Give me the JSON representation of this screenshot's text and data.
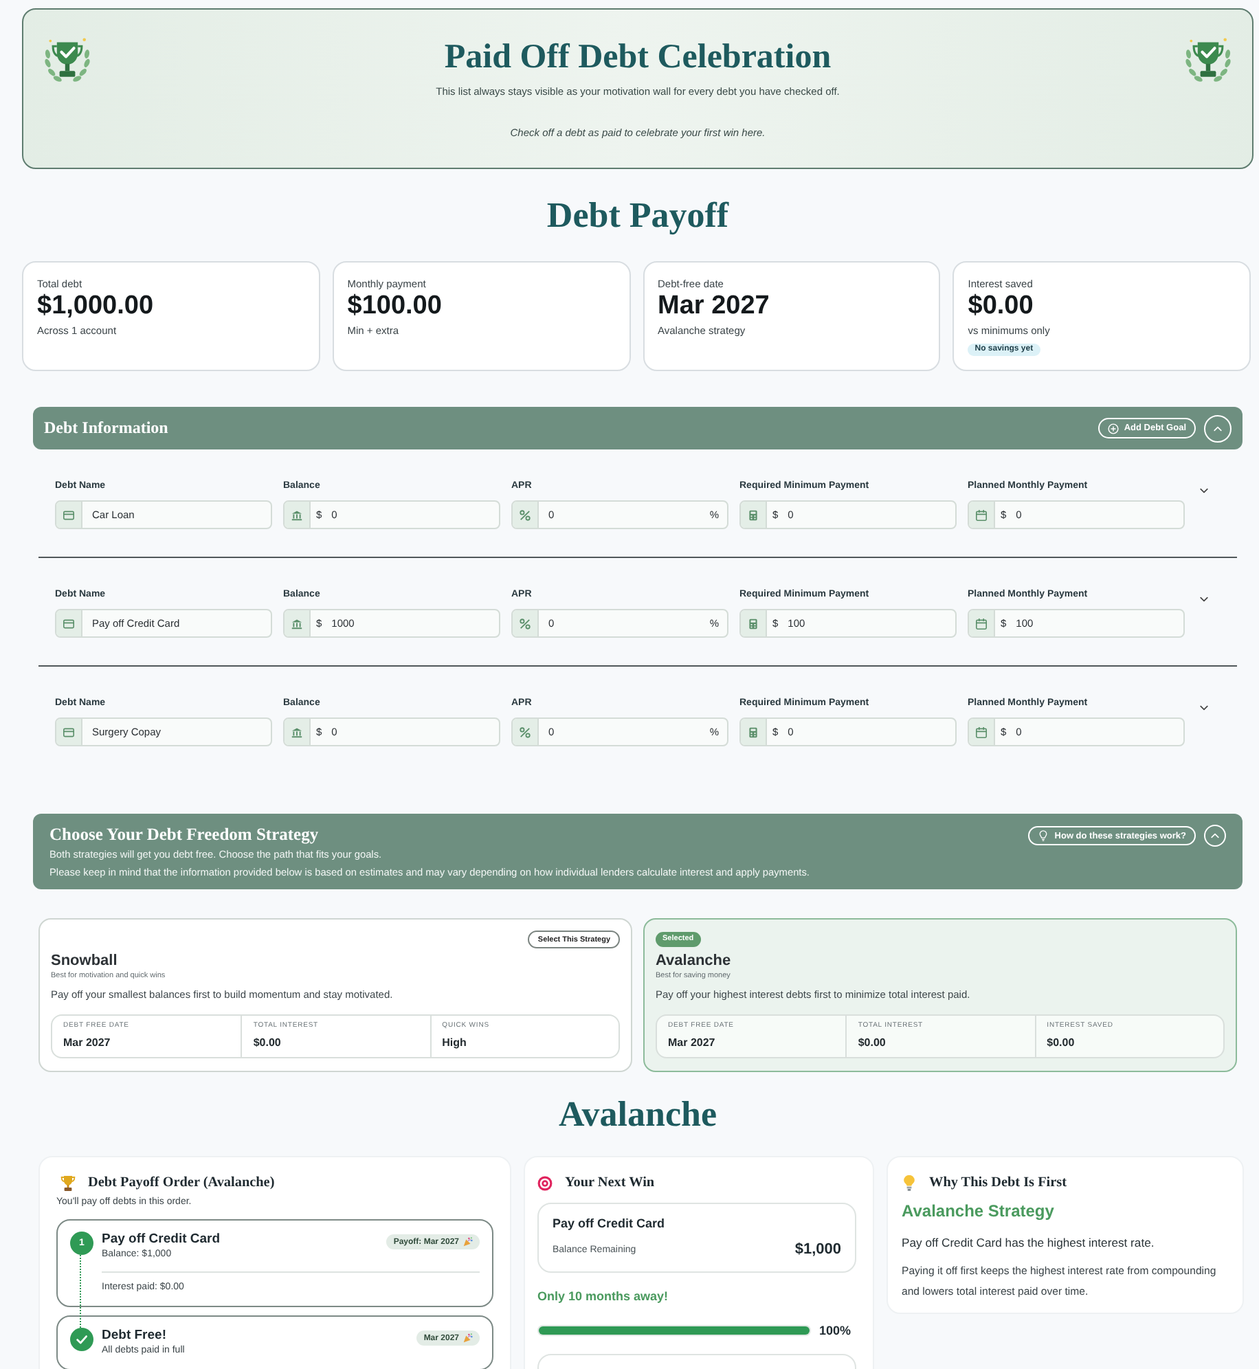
{
  "celebration": {
    "title": "Paid Off Debt Celebration",
    "subtitle": "This list always stays visible as your motivation wall for every debt you have checked off.",
    "empty_message": "Check off a debt as paid to celebrate your first win here."
  },
  "page_title": "Debt Payoff",
  "summary_cards": [
    {
      "label": "Total debt",
      "value": "$1,000.00",
      "note": "Across 1 account"
    },
    {
      "label": "Monthly payment",
      "value": "$100.00",
      "note": "Min + extra"
    },
    {
      "label": "Debt-free date",
      "value": "Mar 2027",
      "note": "Avalanche strategy"
    },
    {
      "label": "Interest saved",
      "value": "$0.00",
      "note": "vs minimums only",
      "badge": "No savings yet"
    }
  ],
  "debt_information": {
    "title": "Debt Information",
    "add_button": "Add Debt Goal",
    "expanded": true,
    "debts": [
      {
        "expanded": false,
        "fields": [
          {
            "kind": "name",
            "label": "Debt Name",
            "value": "Car Loan"
          },
          {
            "kind": "balance",
            "label": "Balance",
            "prefix": "$",
            "value": "0"
          },
          {
            "kind": "apr",
            "label": "APR",
            "value": "0",
            "suffix": "%"
          },
          {
            "kind": "minimum",
            "label": "Required Minimum Payment",
            "prefix": "$",
            "value": "0"
          },
          {
            "kind": "planned",
            "label": "Planned Monthly Payment",
            "prefix": "$",
            "value": "0"
          }
        ]
      },
      {
        "expanded": false,
        "fields": [
          {
            "kind": "name",
            "label": "Debt Name",
            "value": "Pay off Credit Card"
          },
          {
            "kind": "balance",
            "label": "Balance",
            "prefix": "$",
            "value": "1000"
          },
          {
            "kind": "apr",
            "label": "APR",
            "value": "0",
            "suffix": "%"
          },
          {
            "kind": "minimum",
            "label": "Required Minimum Payment",
            "prefix": "$",
            "value": "100"
          },
          {
            "kind": "planned",
            "label": "Planned Monthly Payment",
            "prefix": "$",
            "value": "100"
          }
        ]
      },
      {
        "expanded": false,
        "fields": [
          {
            "kind": "name",
            "label": "Debt Name",
            "value": "Surgery Copay"
          },
          {
            "kind": "balance",
            "label": "Balance",
            "prefix": "$",
            "value": "0"
          },
          {
            "kind": "apr",
            "label": "APR",
            "value": "0",
            "suffix": "%"
          },
          {
            "kind": "minimum",
            "label": "Required Minimum Payment",
            "prefix": "$",
            "value": "0"
          },
          {
            "kind": "planned",
            "label": "Planned Monthly Payment",
            "prefix": "$",
            "value": "0"
          }
        ]
      }
    ]
  },
  "strategy": {
    "title": "Choose Your Debt Freedom Strategy",
    "description": [
      "Both strategies will get you debt free. Choose the path that fits your goals.",
      "Please keep in mind that the information provided below is based on estimates and may vary depending on how individual lenders calculate interest and apply payments."
    ],
    "help_button": "How do these strategies work?",
    "expanded": true,
    "options": [
      {
        "name": "Snowball",
        "tagline": "Best for motivation and quick wins",
        "description": "Pay off your smallest balances first to build momentum and stay motivated.",
        "action": "Select This Strategy",
        "selected": false,
        "stats": [
          {
            "label": "DEBT FREE DATE",
            "value": "Mar 2027"
          },
          {
            "label": "TOTAL INTEREST",
            "value": "$0.00"
          },
          {
            "label": "QUICK WINS",
            "value": "High"
          }
        ]
      },
      {
        "name": "Avalanche",
        "tagline": "Best for saving money",
        "description": "Pay off your highest interest debts first to minimize total interest paid.",
        "action": "Selected",
        "selected": true,
        "stats": [
          {
            "label": "DEBT FREE DATE",
            "value": "Mar 2027"
          },
          {
            "label": "TOTAL INTEREST",
            "value": "$0.00"
          },
          {
            "label": "INTEREST SAVED",
            "value": "$0.00"
          }
        ]
      }
    ]
  },
  "plan_title": "Avalanche",
  "payoff_order": {
    "title": "Debt Payoff Order (Avalanche)",
    "subtitle": "You'll pay off debts in this order.",
    "steps": [
      {
        "kind": "debt",
        "marker": "1",
        "name": "Pay off Credit Card",
        "detail": "Balance: $1,000",
        "badge": "Payoff: Mar 2027",
        "note": "Interest paid: $0.00"
      },
      {
        "kind": "finish",
        "name": "Debt Free!",
        "detail": "All debts paid in full",
        "badge": "Mar 2027"
      }
    ]
  },
  "next_win": {
    "title": "Your Next Win",
    "debt_name": "Pay off Credit Card",
    "balance_label": "Balance Remaining",
    "balance": "$1,000",
    "countdown": "Only 10 months away!",
    "progress": {
      "level": 1,
      "reading": "100%"
    }
  },
  "why_first": {
    "title": "Why This Debt Is First",
    "strategy": "Avalanche Strategy",
    "lead": "Pay off Credit Card has the highest interest rate.",
    "body": "Paying it off first keeps the highest interest rate from compounding and lowers total interest paid over time."
  }
}
